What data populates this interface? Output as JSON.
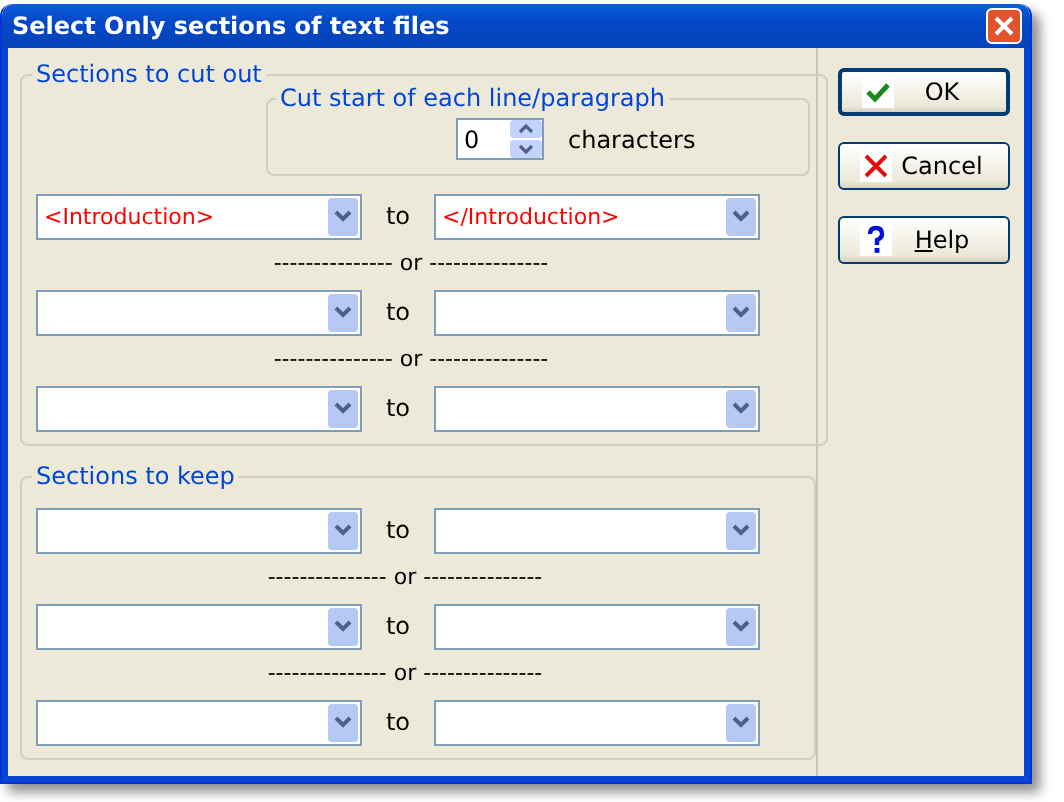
{
  "window": {
    "title": "Select Only sections of text files"
  },
  "cut_out": {
    "legend": "Sections to cut out",
    "cut_start": {
      "legend": "Cut start of each line/paragraph",
      "value": "0",
      "unit": "characters"
    },
    "rows": [
      {
        "from": "<Introduction>",
        "to_label": "to",
        "to": "</Introduction>"
      },
      {
        "from": "",
        "to_label": "to",
        "to": ""
      },
      {
        "from": "",
        "to_label": "to",
        "to": ""
      }
    ],
    "separators": [
      "--------------- or ---------------",
      "--------------- or ---------------"
    ]
  },
  "keep": {
    "legend": "Sections to keep",
    "rows": [
      {
        "from": "",
        "to_label": "to",
        "to": ""
      },
      {
        "from": "",
        "to_label": "to",
        "to": ""
      },
      {
        "from": "",
        "to_label": "to",
        "to": ""
      }
    ],
    "separators": [
      "--------------- or ---------------",
      "--------------- or ---------------"
    ]
  },
  "buttons": [
    {
      "kind": "ok",
      "label": "OK",
      "default": true,
      "underline_first": false
    },
    {
      "kind": "cancel",
      "label": "Cancel",
      "default": false,
      "underline_first": false
    },
    {
      "kind": "help",
      "label": "Help",
      "default": false,
      "underline_first": true
    }
  ]
}
